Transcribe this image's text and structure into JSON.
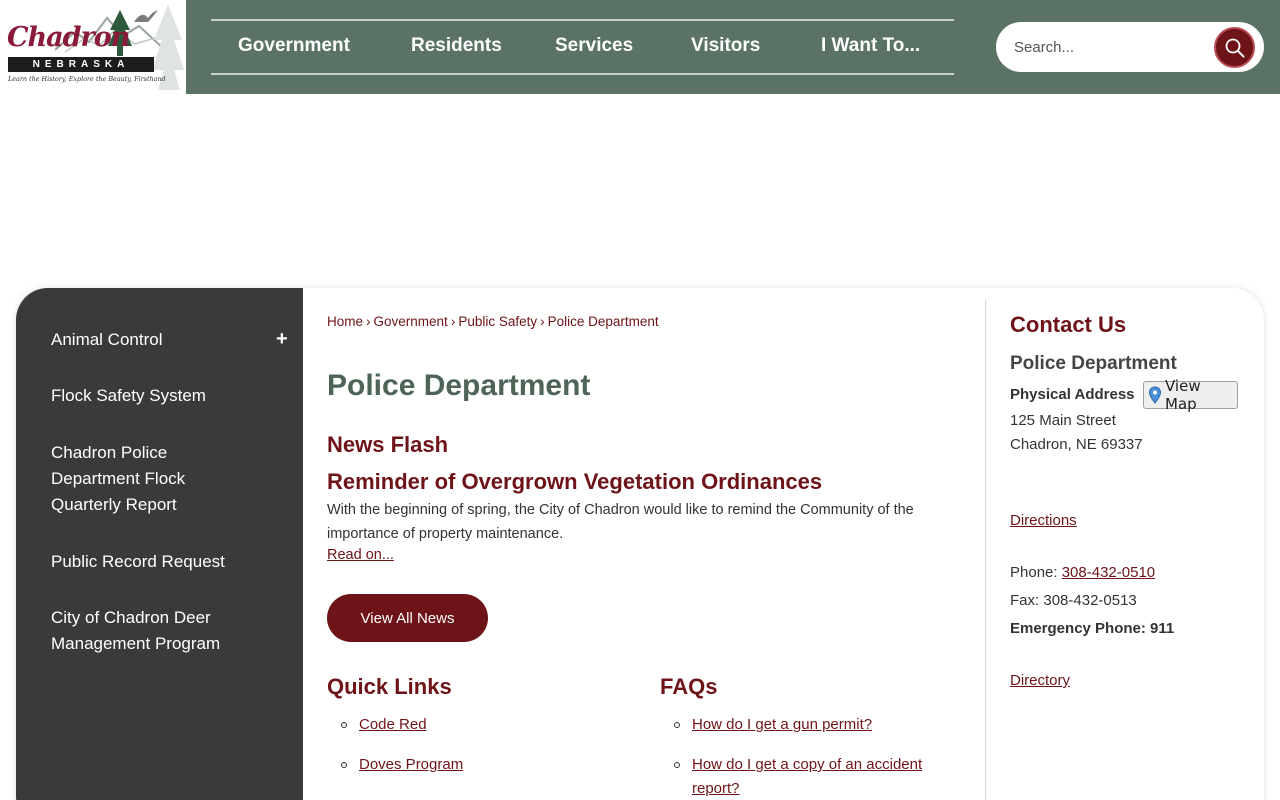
{
  "logo": {
    "script": "Chadron",
    "state": "NEBRASKA",
    "tagline": "Learn the History, Explore the Beauty, Firsthand"
  },
  "nav": {
    "items": [
      "Government",
      "Residents",
      "Services",
      "Visitors",
      "I Want To..."
    ]
  },
  "search": {
    "placeholder": "Search..."
  },
  "sidebar": {
    "items": [
      "Animal Control",
      "Flock Safety System",
      "Chadron Police Department Flock Quarterly Report",
      "Public Record Request",
      "City of Chadron Deer Management Program"
    ],
    "expand_symbol": "+"
  },
  "breadcrumb": {
    "items": [
      "Home",
      "Government",
      "Public Safety",
      "Police Department"
    ],
    "separator": "›"
  },
  "page": {
    "title": "Police Department"
  },
  "news": {
    "heading": "News Flash",
    "title": "Reminder of Overgrown Vegetation Ordinances",
    "body": "With the beginning of spring, the City of Chadron would like to remind the Community of the importance of property maintenance.",
    "read_on": "Read on...",
    "view_all": "View All News"
  },
  "quick_links": {
    "heading": "Quick Links",
    "items": [
      "Code Red",
      "Doves Program"
    ]
  },
  "faqs": {
    "heading": "FAQs",
    "items": [
      "How do I get a gun permit?",
      "How do I get a copy of an accident report?"
    ]
  },
  "contact": {
    "title": "Contact Us",
    "department": "Police Department",
    "address_label": "Physical Address",
    "view_map": "View Map",
    "address_line1": "125 Main Street",
    "address_line2": "Chadron, NE 69337",
    "directions": "Directions",
    "phone_label": "Phone:",
    "phone": "308-432-0510",
    "fax_label": "Fax:",
    "fax": "308-432-0513",
    "emergency": "Emergency Phone: 911",
    "directory": "Directory"
  },
  "colors": {
    "header_green": "#5b7365",
    "accent_maroon": "#6e1419",
    "sidebar_dark": "#3a3a3a",
    "title_green": "#4e6457"
  }
}
